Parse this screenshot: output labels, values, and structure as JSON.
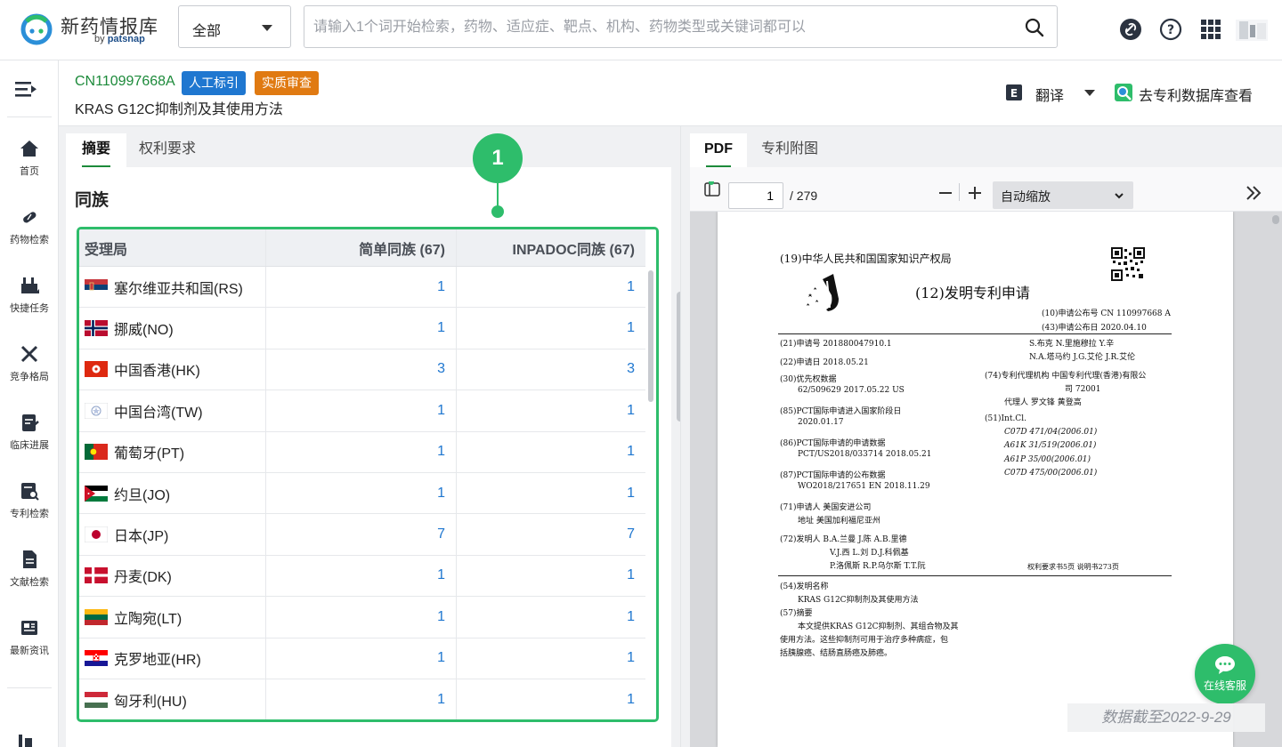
{
  "header": {
    "logo_name": "新药情报库",
    "logo_sub_by": "by",
    "logo_sub_brand": "patsnap",
    "scope_select": "全部",
    "search_placeholder": "请输入1个词开始检索，药物、适应症、靶点、机构、药物类型或关键词都可以"
  },
  "sidebar": {
    "items": [
      {
        "label": "首页",
        "icon": "home-icon"
      },
      {
        "label": "药物检索",
        "icon": "pill-icon"
      },
      {
        "label": "快捷任务",
        "icon": "tasks-icon"
      },
      {
        "label": "竞争格局",
        "icon": "swords-icon"
      },
      {
        "label": "临床进展",
        "icon": "clipboard-icon"
      },
      {
        "label": "专利检索",
        "icon": "patent-icon"
      },
      {
        "label": "文献检索",
        "icon": "document-icon"
      },
      {
        "label": "最新资讯",
        "icon": "news-icon"
      }
    ]
  },
  "patent": {
    "number": "CN110997668A",
    "tag_manual": "人工标引",
    "tag_exam": "实质审查",
    "title": "KRAS G12C抑制剂及其使用方法",
    "translate_label": "翻译",
    "goto_db_label": "去专利数据库查看"
  },
  "left_tabs": [
    "摘要",
    "权利要求"
  ],
  "family": {
    "section_title": "同族",
    "callout": "1",
    "columns": [
      "受理局",
      "简单同族 (67)",
      "INPADOC同族 (67)"
    ],
    "rows": [
      {
        "country": "塞尔维亚共和国(RS)",
        "simple": "1",
        "inpadoc": "1",
        "flag": "rs"
      },
      {
        "country": "挪威(NO)",
        "simple": "1",
        "inpadoc": "1",
        "flag": "no"
      },
      {
        "country": "中国香港(HK)",
        "simple": "3",
        "inpadoc": "3",
        "flag": "hk"
      },
      {
        "country": "中国台湾(TW)",
        "simple": "1",
        "inpadoc": "1",
        "flag": "tw"
      },
      {
        "country": "葡萄牙(PT)",
        "simple": "1",
        "inpadoc": "1",
        "flag": "pt"
      },
      {
        "country": "约旦(JO)",
        "simple": "1",
        "inpadoc": "1",
        "flag": "jo"
      },
      {
        "country": "日本(JP)",
        "simple": "7",
        "inpadoc": "7",
        "flag": "jp"
      },
      {
        "country": "丹麦(DK)",
        "simple": "1",
        "inpadoc": "1",
        "flag": "dk"
      },
      {
        "country": "立陶宛(LT)",
        "simple": "1",
        "inpadoc": "1",
        "flag": "lt"
      },
      {
        "country": "克罗地亚(HR)",
        "simple": "1",
        "inpadoc": "1",
        "flag": "hr"
      },
      {
        "country": "匈牙利(HU)",
        "simple": "1",
        "inpadoc": "1",
        "flag": "hu"
      }
    ]
  },
  "right_tabs": [
    "PDF",
    "专利附图"
  ],
  "pdf": {
    "page_current": "1",
    "page_total": "/ 279",
    "zoom_label": "自动缩放",
    "page": {
      "authority": "(19)中华人民共和国国家知识产权局",
      "doc_type": "(12)发明专利申请",
      "pub_no": "(10)申请公布号 CN 110997668 A",
      "pub_date": "(43)申请公布日 2020.04.10",
      "app_no": "(21)申请号 201880047910.1",
      "app_date": "(22)申请日 2018.05.21",
      "priority_label": "(30)优先权数据",
      "priority_value": "62/509629 2017.05.22 US",
      "pct_entry_label": "(85)PCT国际申请进入国家阶段日",
      "pct_entry_value": "2020.01.17",
      "pct_app_label": "(86)PCT国际申请的申请数据",
      "pct_app_value": "PCT/US2018/033714 2018.05.21",
      "pct_pub_label": "(87)PCT国际申请的公布数据",
      "pct_pub_value": "WO2018/217651 EN 2018.11.29",
      "applicant": "(71)申请人 美国安进公司",
      "address": "地址 美国加利福尼亚州",
      "inventors_1": "(72)发明人 B.A.兰曼  J.陈  A.B.里德",
      "inventors_2": "V.J.西  L.刘  D.J.科佩基",
      "inventors_3": "P.洛佩斯  R.P.乌尔斯  T.T.阮",
      "right_names_1": "S.布克  N.里施穆拉  Y.辛",
      "right_names_2": "N.A.塔马约  J.G.艾伦  J.R.艾伦",
      "agency": "(74)专利代理机构 中国专利代理(香港)有限公",
      "agency_2": "司 72001",
      "agent": "代理人 罗文锋  黄登高",
      "ipc_label": "(51)Int.Cl.",
      "ipc_1": "C07D 471/04(2006.01)",
      "ipc_2": "A61K 31/519(2006.01)",
      "ipc_3": "A61P 35/00(2006.01)",
      "ipc_4": "C07D 475/00(2006.01)",
      "page_counts": "权利要求书5页  说明书273页",
      "title_label": "(54)发明名称",
      "title_value": "KRAS G12C抑制剂及其使用方法",
      "abstract_label": "(57)摘要",
      "abstract_1": "本文提供KRAS G12C抑制剂、其组合物及其",
      "abstract_2": "使用方法。这些抑制剂可用于治疗多种病症，包",
      "abstract_3": "括胰腺癌、结肠直肠癌及肺癌。"
    }
  },
  "chat_label": "在线客服",
  "data_as_of": "数据截至2022-9-29",
  "colors": {
    "accent_green": "#2ebd6b",
    "link_blue": "#1f77d0",
    "tag_blue": "#1f77d0",
    "tag_orange": "#e07a12",
    "patent_number_green": "#1c8a3a"
  }
}
